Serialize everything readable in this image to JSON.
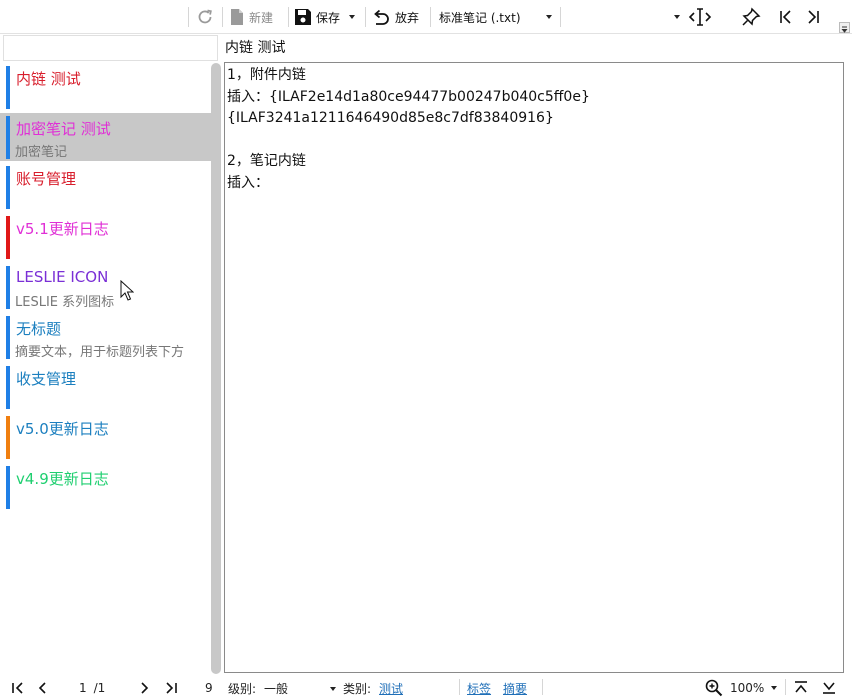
{
  "toolbar": {
    "refresh_icon": "refresh-icon",
    "new_label": "新建",
    "save_label": "保存",
    "discard_label": "放弃",
    "format_value": "标准笔记 (.txt)"
  },
  "search": {
    "placeholder": ""
  },
  "notes": [
    {
      "title": "内链 测试",
      "summary": "",
      "bar_color": "#1f7fe6",
      "title_color": "#d81e2c"
    },
    {
      "title": "加密笔记 测试",
      "summary": "加密笔记",
      "bar_color": "#1f7fe6",
      "title_color": "#e02fd6"
    },
    {
      "title": "账号管理",
      "summary": "",
      "bar_color": "#1f7fe6",
      "title_color": "#d81e2c"
    },
    {
      "title": "v5.1更新日志",
      "summary": "",
      "bar_color": "#e01818",
      "title_color": "#e02fd6"
    },
    {
      "title": "LESLIE ICON",
      "summary": "LESLIE  系列图标",
      "bar_color": "#1f7fe6",
      "title_color": "#7a2fd6"
    },
    {
      "title": "无标题",
      "summary": "摘要文本，用于标题列表下方",
      "bar_color": "#1f7fe6",
      "title_color": "#1b7fbf"
    },
    {
      "title": "收支管理",
      "summary": "",
      "bar_color": "#1f7fe6",
      "title_color": "#1b7fbf"
    },
    {
      "title": "v5.0更新日志",
      "summary": "",
      "bar_color": "#f07f10",
      "title_color": "#1b7fbf"
    },
    {
      "title": "v4.9更新日志",
      "summary": "",
      "bar_color": "#1f7fe6",
      "title_color": "#1fcf70"
    }
  ],
  "editor": {
    "note_title": "内链 测试",
    "lines": [
      "1，附件内链",
      "插入：{ILAF2e14d1a80ce94477b00247b040c5ff0e}",
      "{ILAF3241a1211646490d85e8c7df83840916}",
      "",
      "2，笔记内链",
      "插入："
    ]
  },
  "bottom": {
    "page_current": "1",
    "page_sep": "/1",
    "count": "9",
    "level_label": "级别:",
    "level_value": "一般",
    "category_label": "类别:",
    "category_value": "测试",
    "tags_link": "标签",
    "summary_link": "摘要",
    "zoom_value": "100%"
  }
}
